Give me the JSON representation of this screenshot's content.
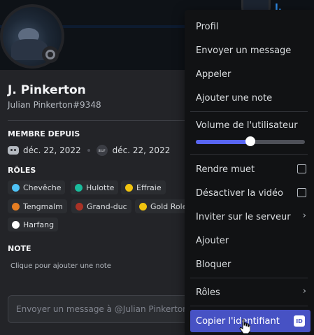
{
  "background": {
    "other_user_name": "J. Pinkerton"
  },
  "profile": {
    "display_name": "J. Pinkerton",
    "username": "Julian Pinkerton#9348",
    "member_since_title": "MEMBRE DEPUIS",
    "discord_join_date": "déc. 22, 2022",
    "server_icon_text": "BLUF",
    "server_join_date": "déc. 22, 2022",
    "roles_title": "RÔLES",
    "roles": [
      {
        "name": "Chevêche",
        "color": "#4fc3f7"
      },
      {
        "name": "Hulotte",
        "color": "#1abc9c"
      },
      {
        "name": "Effraie",
        "color": "#f1c40f"
      },
      {
        "name": "Tengmalm",
        "color": "#e67e22"
      },
      {
        "name": "Grand-duc",
        "color": "#a93226"
      },
      {
        "name": "Gold Role",
        "color": "#f1c40f"
      },
      {
        "name": "Harfang",
        "color": "#ffffff"
      }
    ],
    "note_title": "NOTE",
    "note_placeholder": "Clique pour ajouter une note",
    "message_placeholder": "Envoyer un message à @Julian Pinkerton"
  },
  "context_menu": {
    "profile": "Profil",
    "send_message": "Envoyer un message",
    "call": "Appeler",
    "add_note": "Ajouter une note",
    "user_volume": "Volume de l'utilisateur",
    "volume_level": 0.5,
    "mute": "Rendre muet",
    "disable_video": "Désactiver la vidéo",
    "invite_to_server": "Inviter sur le serveur",
    "add_friend": "Ajouter",
    "block": "Bloquer",
    "roles": "Rôles",
    "copy_id": "Copier l'identifiant",
    "id_badge": "ID",
    "accent_color": "#4752c4"
  }
}
